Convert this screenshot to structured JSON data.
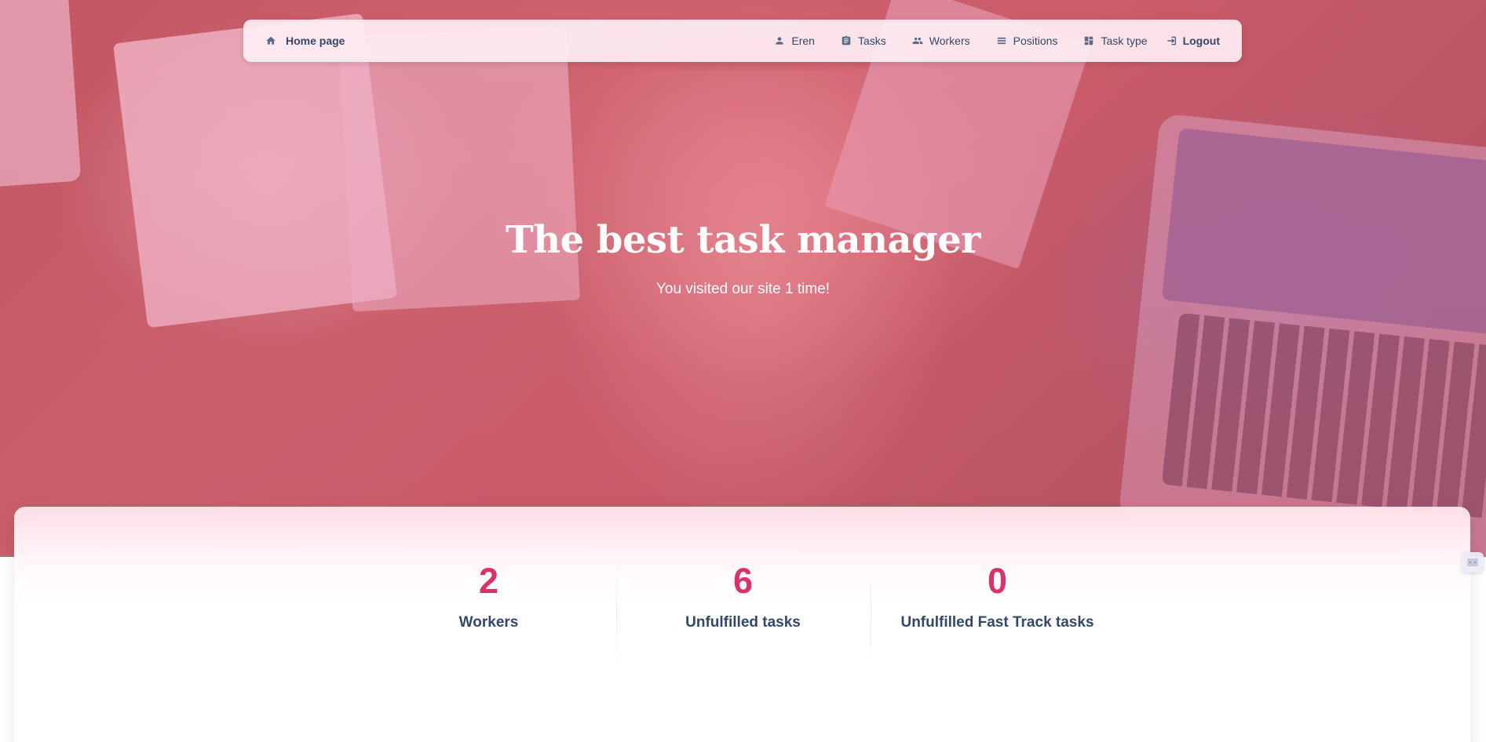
{
  "nav": {
    "brand_label": "Home page",
    "items": [
      {
        "label": "Eren",
        "icon": "person-icon"
      },
      {
        "label": "Tasks",
        "icon": "clipboard-icon"
      },
      {
        "label": "Workers",
        "icon": "people-icon"
      },
      {
        "label": "Positions",
        "icon": "list-icon"
      },
      {
        "label": "Task type",
        "icon": "dashboard-icon"
      }
    ],
    "logout_label": "Logout"
  },
  "hero": {
    "title": "The best task manager",
    "subtitle": "You visited our site 1 time!"
  },
  "stats": [
    {
      "value": "2",
      "label": "Workers"
    },
    {
      "value": "6",
      "label": "Unfulfilled tasks"
    },
    {
      "value": "0",
      "label": "Unfulfilled Fast Track tasks"
    }
  ],
  "colors": {
    "accent": "#d8326b",
    "text_dark": "#344767",
    "hero_overlay": "#ec407a"
  }
}
